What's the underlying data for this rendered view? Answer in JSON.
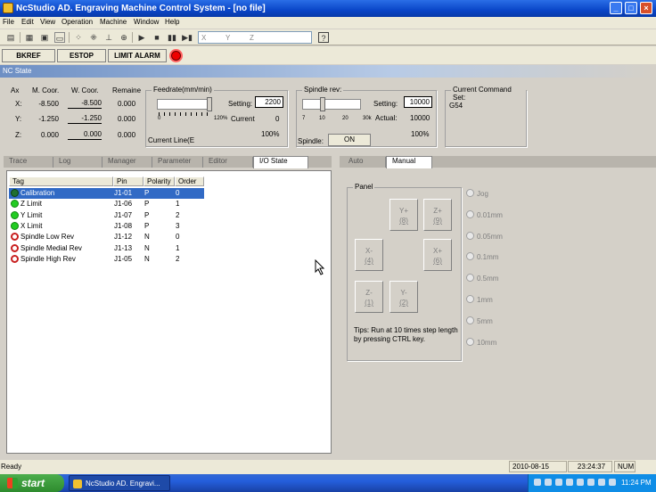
{
  "window": {
    "title": "NcStudio AD. Engraving Machine Control System  - [no file]"
  },
  "menu": [
    "File",
    "Edit",
    "View",
    "Operation",
    "Machine",
    "Window",
    "Help"
  ],
  "toolbar": {
    "coord_labels": [
      "X",
      "Y",
      "Z"
    ]
  },
  "alarm_bar": {
    "bkref": "BKREF",
    "estop": "ESTOP",
    "limit_alarm": "LIMIT ALARM",
    "lamp_color": "#e00000"
  },
  "nc_state": {
    "header": "NC State",
    "col_axis": "Ax",
    "col_mcoor": "M. Coor.",
    "col_wcoor": "W. Coor.",
    "col_remain": "Remaine",
    "axes": [
      {
        "name": "X:",
        "mcoor": "-8.500",
        "wcoor": "-8.500",
        "remain": "0.000"
      },
      {
        "name": "Y:",
        "mcoor": "-1.250",
        "wcoor": "-1.250",
        "remain": "0.000"
      },
      {
        "name": "Z:",
        "mcoor": "0.000",
        "wcoor": "0.000",
        "remain": "0.000"
      }
    ],
    "feedrate": {
      "title": "Feedrate(mm/min)",
      "scale_min": "0",
      "scale_max": "120%",
      "setting_label": "Setting:",
      "setting_value": "2200",
      "current_label": "Current",
      "current_value": "0",
      "percent": "100%",
      "current_line_label": "Current Line(E"
    },
    "spindle": {
      "title": "Spindle rev:",
      "ticks": [
        "7",
        "10",
        "20",
        "30k"
      ],
      "setting_label": "Setting:",
      "setting_value": "10000",
      "actual_label": "Actual:",
      "actual_value": "10000",
      "percent": "100%",
      "spindle_label": "Spindle:",
      "on_button": "ON"
    },
    "command_set": {
      "title": "Current Command Set:",
      "value": "G54"
    }
  },
  "left_tabs": [
    "Trace",
    "Log",
    "Manager",
    "Parameter",
    "Editor",
    "I/O State"
  ],
  "io_table": {
    "headers": [
      "Tag",
      "Pin",
      "Polarity",
      "Order"
    ],
    "rows": [
      {
        "tag": "Calibration",
        "pin": "J1-01",
        "polarity": "P",
        "order": "0",
        "status": "dg",
        "selected": true
      },
      {
        "tag": "Z Limit",
        "pin": "J1-06",
        "polarity": "P",
        "order": "1",
        "status": "g"
      },
      {
        "tag": "Y Limit",
        "pin": "J1-07",
        "polarity": "P",
        "order": "2",
        "status": "g"
      },
      {
        "tag": "X Limit",
        "pin": "J1-08",
        "polarity": "P",
        "order": "3",
        "status": "g"
      },
      {
        "tag": "Spindle Low Rev",
        "pin": "J1-12",
        "polarity": "N",
        "order": "0",
        "status": "r"
      },
      {
        "tag": "Spindle Medial Rev",
        "pin": "J1-13",
        "polarity": "N",
        "order": "1",
        "status": "r"
      },
      {
        "tag": "Spindle High Rev",
        "pin": "J1-05",
        "polarity": "N",
        "order": "2",
        "status": "r"
      }
    ]
  },
  "right_tabs": [
    "Auto",
    "Manual"
  ],
  "manual": {
    "panel_title": "Panel",
    "jog_buttons": {
      "yplus": {
        "label": "Y+",
        "key": "(8)"
      },
      "zplus": {
        "label": "Z+",
        "key": "(9)"
      },
      "xminus": {
        "label": "X-",
        "key": "(4)"
      },
      "xplus": {
        "label": "X+",
        "key": "(6)"
      },
      "zminus": {
        "label": "Z-",
        "key": "(1)"
      },
      "yminus": {
        "label": "Y-",
        "key": "(2)"
      }
    },
    "tips": "Tips: Run at 10 times step length by pressing CTRL key.",
    "step_options": [
      "Jog",
      "0.01mm",
      "0.05mm",
      "0.1mm",
      "0.5mm",
      "1mm",
      "5mm",
      "10mm"
    ]
  },
  "status_bar": {
    "ready": "Ready",
    "date": "2010-08-15",
    "time": "23:24:37",
    "num": "NUM"
  },
  "taskbar": {
    "start": "start",
    "task_item": "NcStudio AD. Engravi...",
    "clock": "11:24 PM"
  }
}
